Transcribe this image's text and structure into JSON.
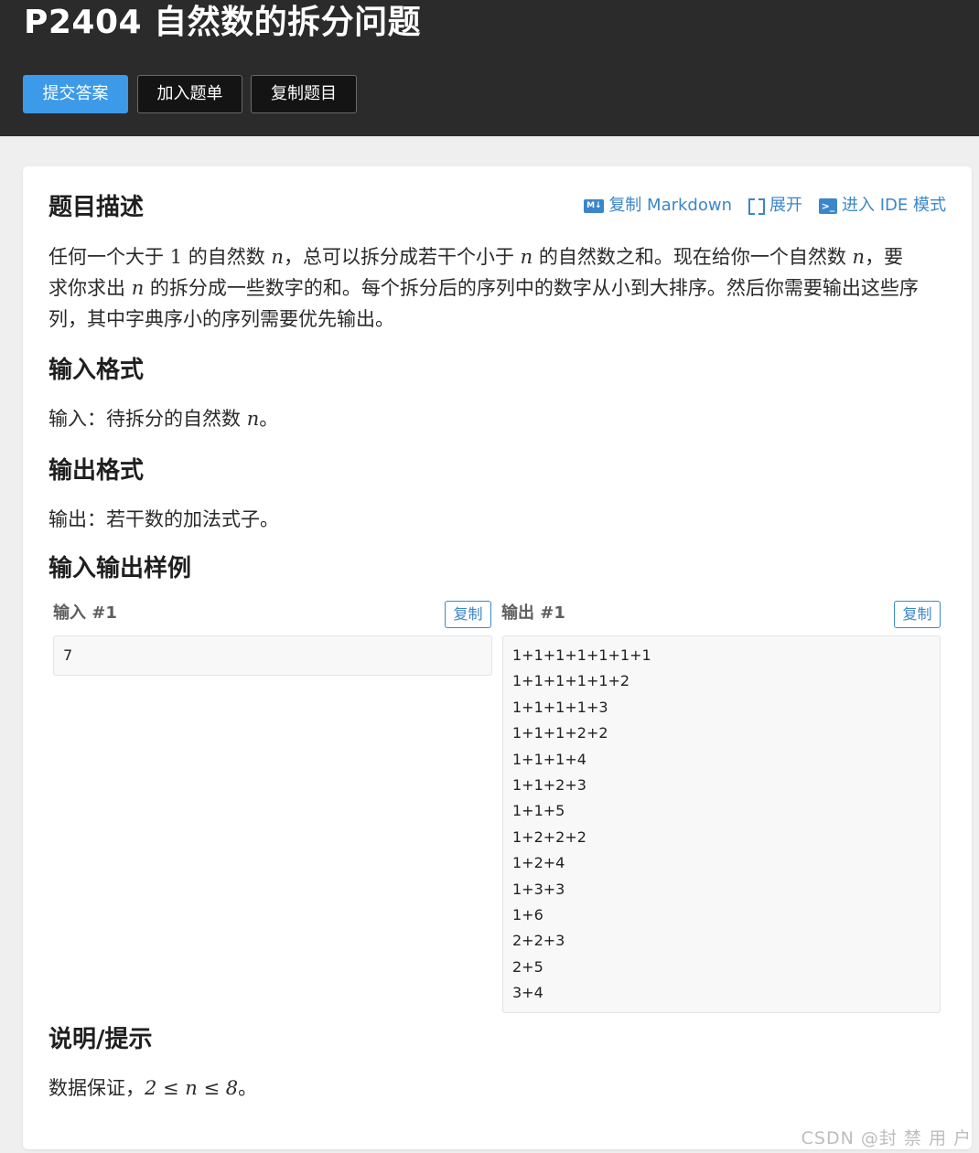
{
  "header": {
    "title": "P2404 自然数的拆分问题",
    "buttons": {
      "submit": "提交答案",
      "add_to_list": "加入题单",
      "copy_problem": "复制题目"
    }
  },
  "actions": {
    "copy_markdown": "复制 Markdown",
    "expand": "展开",
    "ide_mode": "进入 IDE 模式"
  },
  "description": {
    "heading": "题目描述",
    "line1_a": "任何一个大于 ",
    "line1_num": "1",
    "line1_b": " 的自然数 ",
    "line1_var": "n",
    "line1_c": "，总可以拆分成若干个小于 ",
    "line1_var2": "n",
    "line1_d": " 的自然数之和。现在给你一个自然数 ",
    "line1_var3": "n",
    "line1_e": "，要",
    "line2_a": "求你求出 ",
    "line2_var": "n",
    "line2_b": " 的拆分成一些数字的和。每个拆分后的序列中的数字从小到大排序。然后你需要输出这些序",
    "line3": "列，其中字典序小的序列需要优先输出。"
  },
  "input_format": {
    "heading": "输入格式",
    "text": "输入：待拆分的自然数 ",
    "var": "n",
    "end": "。"
  },
  "output_format": {
    "heading": "输出格式",
    "text": "输出：若干数的加法式子。"
  },
  "samples": {
    "heading": "输入输出样例",
    "input_label": "输入 #1",
    "output_label": "输出 #1",
    "copy_label": "复制",
    "input_lines": [
      "7"
    ],
    "output_lines": [
      "1+1+1+1+1+1+1",
      "1+1+1+1+1+2",
      "1+1+1+1+3",
      "1+1+1+2+2",
      "1+1+1+4",
      "1+1+2+3",
      "1+1+5",
      "1+2+2+2",
      "1+2+4",
      "1+3+3",
      "1+6",
      "2+2+3",
      "2+5",
      "3+4"
    ]
  },
  "hint": {
    "heading": "说明/提示",
    "prefix": "数据保证，",
    "math": "2 ≤ n ≤ 8",
    "end": "。"
  },
  "watermark": "CSDN @封 禁 用 户",
  "colors": {
    "header_bg": "#2b2b2b",
    "accent": "#3b86c9",
    "submit_bg": "#3d9ae8",
    "page_bg": "#efefef"
  }
}
